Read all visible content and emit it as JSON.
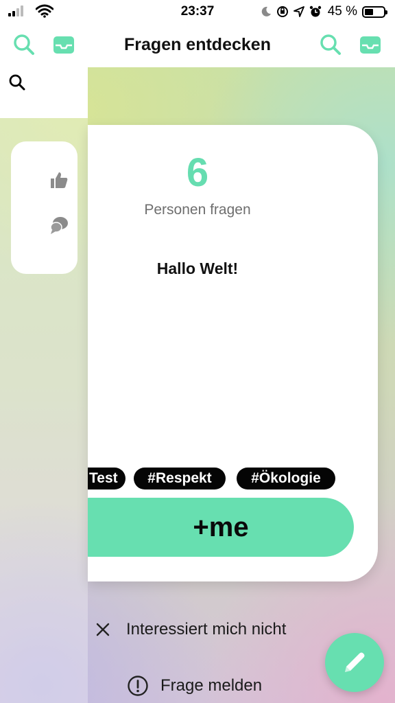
{
  "status_bar": {
    "time": "23:37",
    "battery_percent": "45 %",
    "icons": [
      "signal-icon",
      "wifi-icon",
      "moon-icon",
      "orientation-lock-icon",
      "location-icon",
      "alarm-icon",
      "battery-icon"
    ]
  },
  "header": {
    "title": "Fragen entdecken",
    "left_icons": [
      "search-icon",
      "inbox-icon"
    ],
    "right_icons": [
      "search-icon",
      "inbox-icon"
    ]
  },
  "colors": {
    "accent": "#67dfb0",
    "count_color": "#66ddb0",
    "tag_bg": "#050505"
  },
  "side_card": {
    "icons": [
      "thumbs-up-icon",
      "speech-bubbles-icon"
    ]
  },
  "card": {
    "count": "6",
    "count_label": "Personen fragen",
    "question": "Hallo Welt!",
    "tags": [
      "Test",
      "#Respekt",
      "#Ökologie"
    ],
    "me_button": "+me"
  },
  "actions": {
    "not_interested": "Interessiert mich nicht",
    "report": "Frage melden"
  },
  "fab": {
    "icon": "pencil-icon"
  }
}
